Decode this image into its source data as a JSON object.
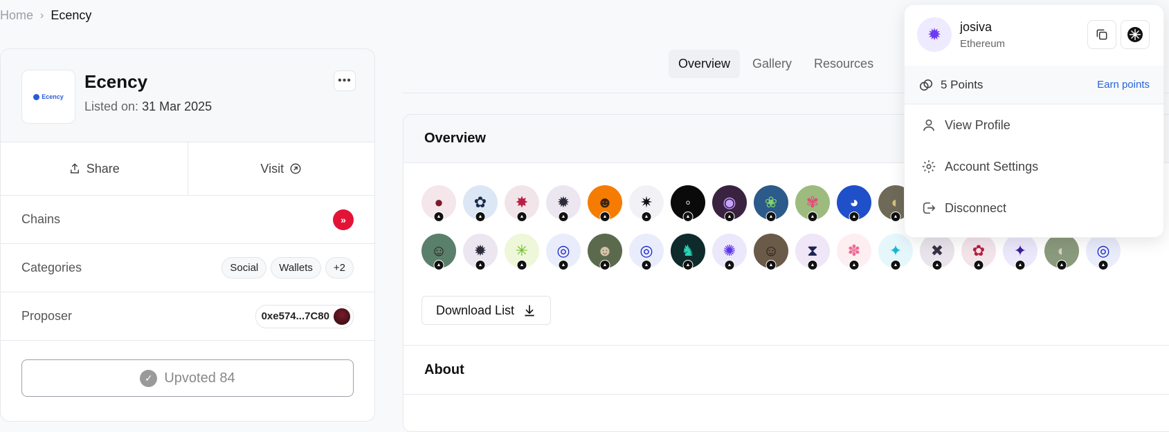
{
  "breadcrumb": {
    "home": "Home",
    "current": "Ecency"
  },
  "app": {
    "name": "Ecency",
    "listed_label": "Listed on:",
    "listed_date": "31 Mar 2025",
    "logo_text": "Ecency",
    "more": "•••"
  },
  "actions": {
    "share": "Share",
    "visit": "Visit"
  },
  "rows": {
    "chains_label": "Chains",
    "categories_label": "Categories",
    "categories": [
      "Social",
      "Wallets",
      "+2"
    ],
    "proposer_label": "Proposer",
    "proposer_address": "0xe574...7C80"
  },
  "upvote": {
    "label": "Upvoted 84"
  },
  "tabs": [
    "Overview",
    "Gallery",
    "Resources"
  ],
  "overview": {
    "title": "Overview",
    "download": "Download List",
    "about": "About"
  },
  "avatars": {
    "row1": [
      {
        "bg": "#f4e6ea",
        "fg": "#7a1b2a",
        "glyph": "●"
      },
      {
        "bg": "#dbe7f5",
        "fg": "#1c2a4a",
        "glyph": "✿"
      },
      {
        "bg": "#f2e5ea",
        "fg": "#b81f43",
        "glyph": "✸"
      },
      {
        "bg": "#ece6f0",
        "fg": "#2b2b3b",
        "glyph": "✹"
      },
      {
        "bg": "#f57c00",
        "fg": "#3b2315",
        "glyph": "☻"
      },
      {
        "bg": "#f2f2f6",
        "fg": "#111111",
        "glyph": "✷"
      },
      {
        "bg": "#0a0a0a",
        "fg": "#ffffff",
        "glyph": "◦"
      },
      {
        "bg": "#3a2340",
        "fg": "#c9a3ff",
        "glyph": "◉"
      },
      {
        "bg": "#2c5a8a",
        "fg": "#7fd36b",
        "glyph": "❀"
      },
      {
        "bg": "#9dbb7e",
        "fg": "#e24a7a",
        "glyph": "✾"
      },
      {
        "bg": "#1f4fc9",
        "fg": "#ffffff",
        "glyph": "◕"
      },
      {
        "bg": "#6f6a58",
        "fg": "#d4c17a",
        "glyph": "◐"
      }
    ],
    "row2": [
      {
        "bg": "#5a7f6a",
        "fg": "#2a1a12",
        "glyph": "☺"
      },
      {
        "bg": "#ece6f0",
        "fg": "#2b2b3b",
        "glyph": "✹"
      },
      {
        "bg": "#eef7d9",
        "fg": "#6bbf1f",
        "glyph": "✳"
      },
      {
        "bg": "#e9ecfb",
        "fg": "#1422c9",
        "glyph": "◎"
      },
      {
        "bg": "#5b6a4c",
        "fg": "#d7c2a8",
        "glyph": "☻"
      },
      {
        "bg": "#e9ecfb",
        "fg": "#1422c9",
        "glyph": "◎"
      },
      {
        "bg": "#0f2a2a",
        "fg": "#27d6b8",
        "glyph": "♞"
      },
      {
        "bg": "#ece8fb",
        "fg": "#5a33e6",
        "glyph": "✺"
      },
      {
        "bg": "#6a5a48",
        "fg": "#1e1a14",
        "glyph": "☺"
      },
      {
        "bg": "#efe6f7",
        "fg": "#1c2354",
        "glyph": "⧗"
      },
      {
        "bg": "#fdeef2",
        "fg": "#f06b98",
        "glyph": "✽"
      },
      {
        "bg": "#e5f7fb",
        "fg": "#14b6d6",
        "glyph": "✦"
      },
      {
        "bg": "#e9e4ec",
        "fg": "#3b2f45",
        "glyph": "✖"
      },
      {
        "bg": "#f3e4ea",
        "fg": "#b81f43",
        "glyph": "✿"
      },
      {
        "bg": "#ece8fb",
        "fg": "#3a1f9a",
        "glyph": "✦"
      },
      {
        "bg": "#8a9a7c",
        "fg": "#d7d0c0",
        "glyph": "◐"
      },
      {
        "bg": "#e9ecfb",
        "fg": "#1422c9",
        "glyph": "◎"
      }
    ]
  },
  "dropdown": {
    "username": "josiva",
    "chain": "Ethereum",
    "points": "5 Points",
    "earn_points": "Earn points",
    "items": [
      "View Profile",
      "Account Settings",
      "Disconnect"
    ]
  },
  "colors": {
    "accent": "#2563d6",
    "hive_red": "#e31337",
    "dropdown_avatar": "#6c3cf0"
  }
}
